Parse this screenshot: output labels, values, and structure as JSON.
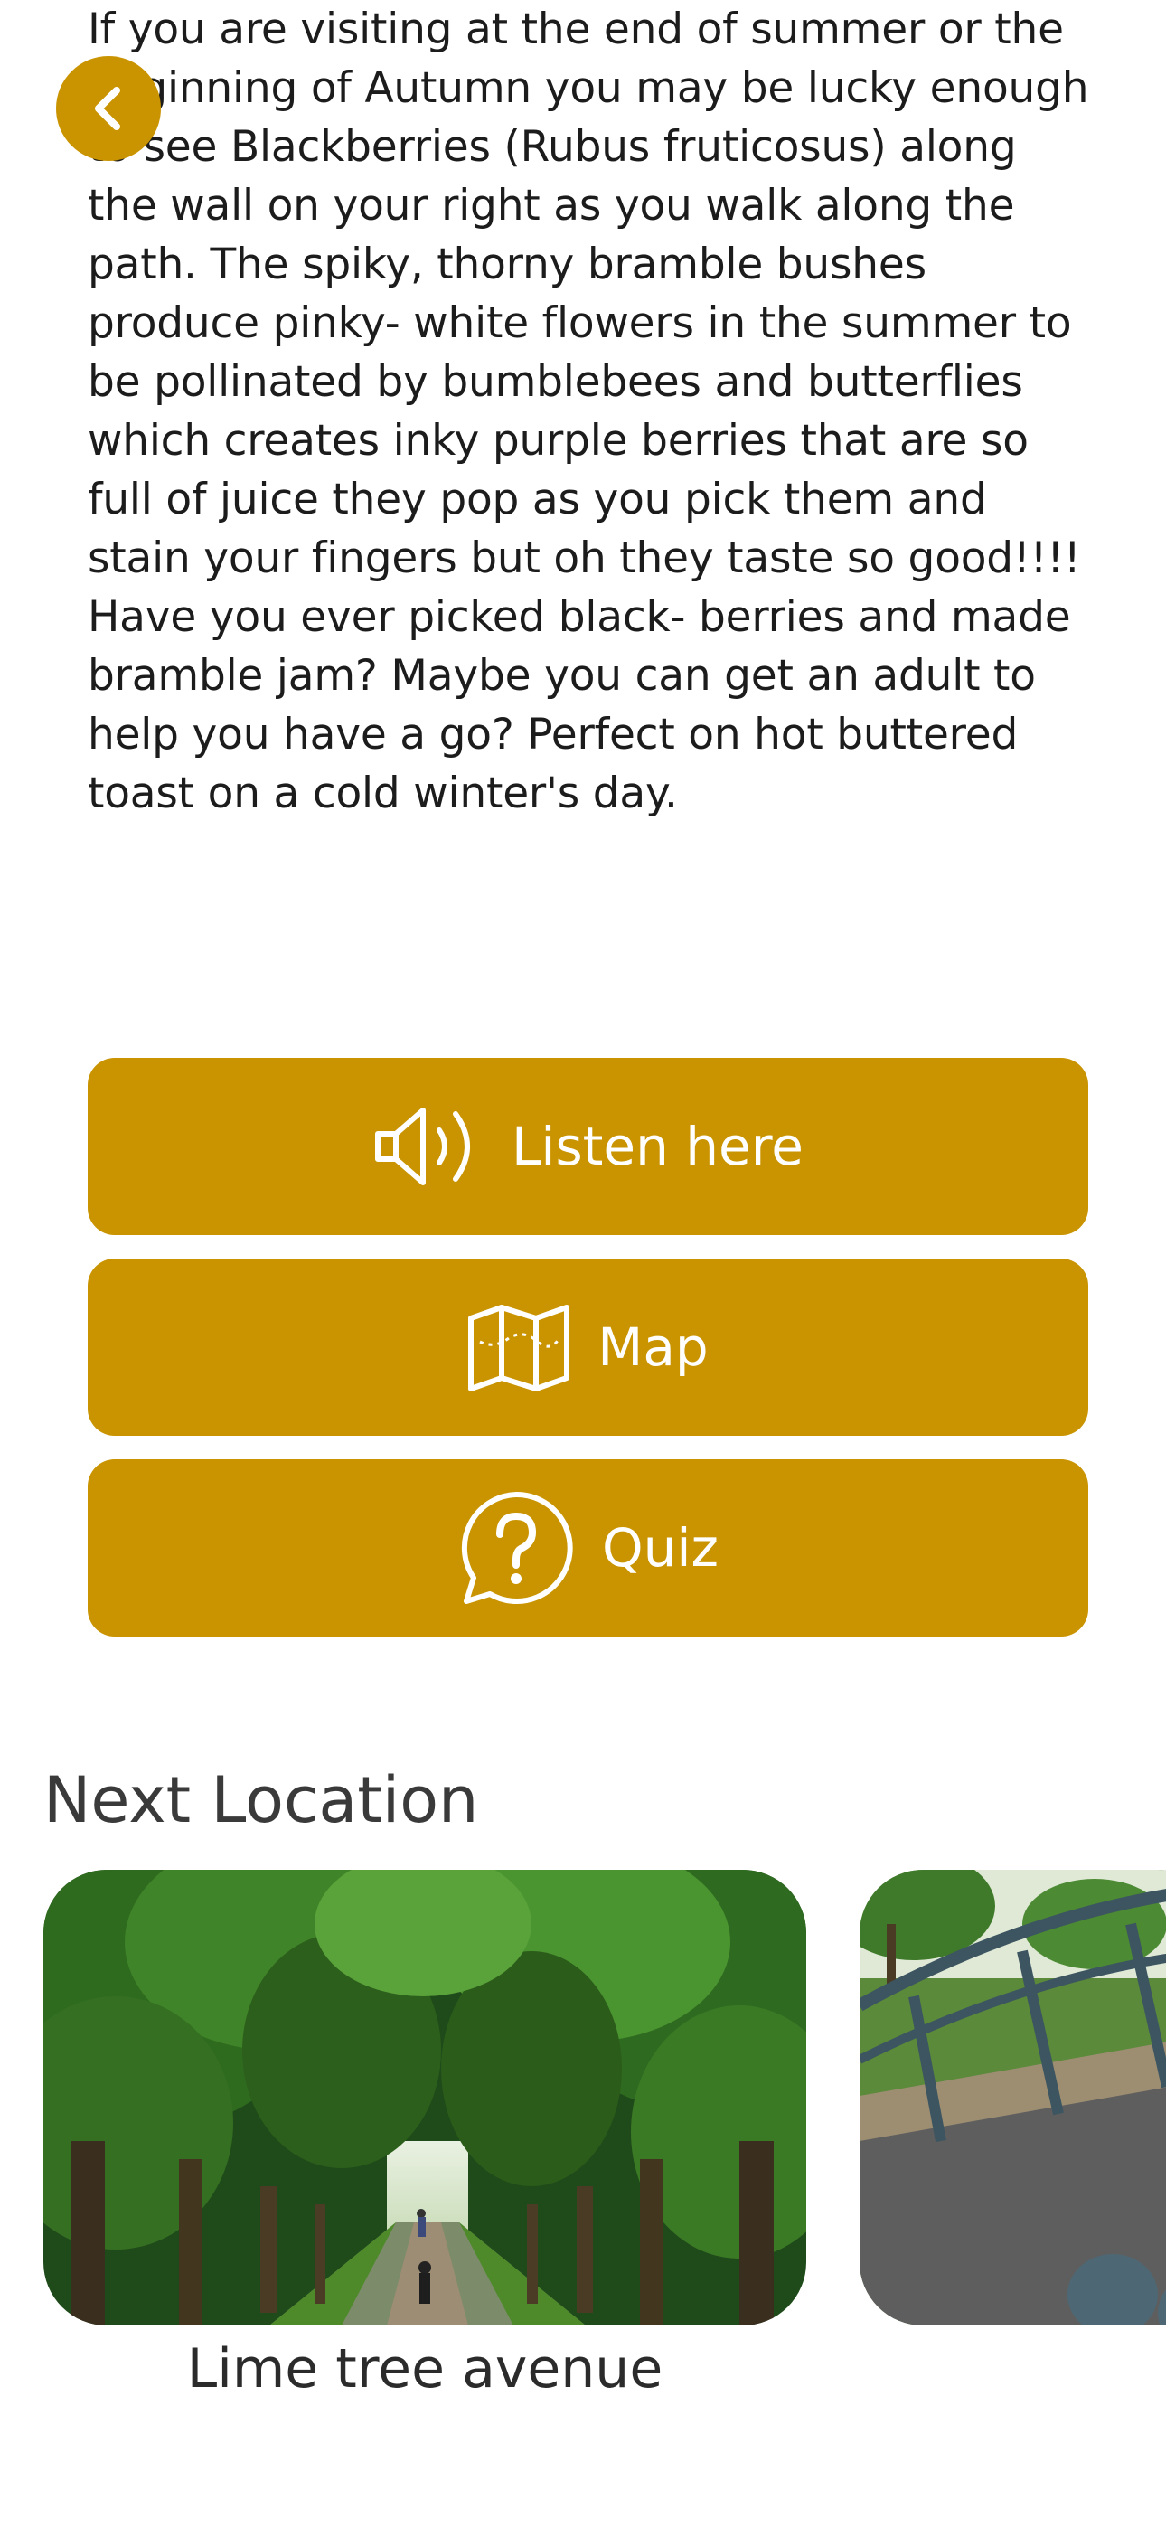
{
  "article": {
    "text": "If you are visiting at the end of summer or the beginning of Autumn you may be lucky enough to see Blackberries (Rubus fruticosus) along the wall on your right as you walk along the path. The spiky, thorny bramble bushes produce pinky- white flowers in the summer to be pollinated by bumblebees and butterflies which creates inky purple berries that are so full of juice they pop as you pick them and stain your fingers but oh they taste so good!!!! Have you ever picked black- berries and made bramble jam? Maybe you can get an adult to help you have a go? Perfect on hot buttered toast on a cold winter's day."
  },
  "nav": {
    "back_icon": "chevron-left-icon"
  },
  "actions": {
    "listen_label": "Listen here",
    "listen_icon": "speaker-icon",
    "map_label": "Map",
    "map_icon": "map-icon",
    "quiz_label": "Quiz",
    "quiz_icon": "question-bubble-icon"
  },
  "next_location": {
    "title": "Next Location",
    "cards": [
      {
        "caption": "Lime tree avenue",
        "image": "tree-lined-avenue-photo"
      },
      {
        "caption": "",
        "image": "bridge-railing-path-photo"
      }
    ]
  },
  "colors": {
    "accent": "#c99400",
    "button_text": "#ffffff",
    "body_text": "#1c1c1c"
  }
}
